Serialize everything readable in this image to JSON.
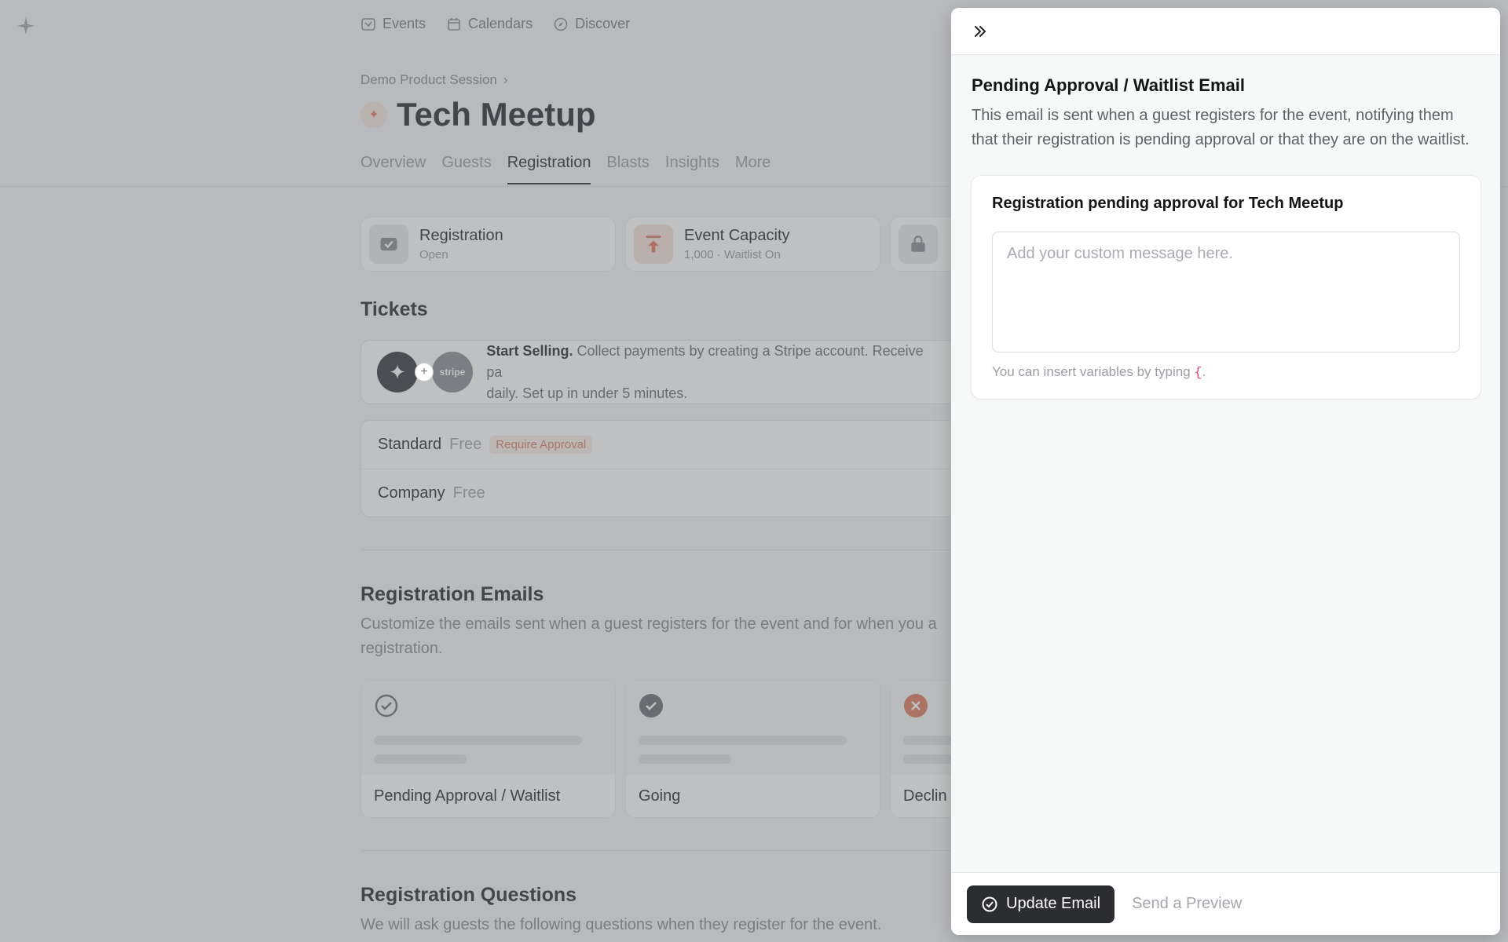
{
  "topnav": {
    "items": [
      {
        "label": "Events",
        "icon": "ticket-icon"
      },
      {
        "label": "Calendars",
        "icon": "calendar-icon"
      },
      {
        "label": "Discover",
        "icon": "compass-icon"
      }
    ]
  },
  "event": {
    "breadcrumb": "Demo Product Session",
    "title": "Tech Meetup"
  },
  "tabs": [
    {
      "label": "Overview",
      "active": false
    },
    {
      "label": "Guests",
      "active": false
    },
    {
      "label": "Registration",
      "active": true
    },
    {
      "label": "Blasts",
      "active": false
    },
    {
      "label": "Insights",
      "active": false
    },
    {
      "label": "More",
      "active": false
    }
  ],
  "stat_cards": [
    {
      "title": "Registration",
      "sub": "Open",
      "icon": "ticket-check-icon",
      "color": "#8a8d92"
    },
    {
      "title": "Event Capacity",
      "sub": "1,000 · Waitlist On",
      "icon": "arrow-up-icon",
      "color": "#e07a5f"
    },
    {
      "title": "",
      "sub": "",
      "icon": "lock-icon",
      "color": "#8a8d92"
    }
  ],
  "tickets": {
    "heading": "Tickets",
    "stripe_bold": "Start Selling.",
    "stripe_text": "Collect payments by creating a Stripe account. Receive pa",
    "stripe_text2": "daily. Set up in under 5 minutes.",
    "stripe_logo": "stripe",
    "rows": [
      {
        "name": "Standard",
        "price": "Free",
        "badge": "Require Approval"
      },
      {
        "name": "Company",
        "price": "Free",
        "badge": ""
      }
    ]
  },
  "reg_emails": {
    "heading": "Registration Emails",
    "desc": "Customize the emails sent when a guest registers for the event and for when you a",
    "desc2": "registration.",
    "cards": [
      {
        "label": "Pending Approval / Waitlist",
        "icon": "check-circle-outline-icon"
      },
      {
        "label": "Going",
        "icon": "check-circle-filled-icon"
      },
      {
        "label": "Declin",
        "icon": "x-circle-icon"
      }
    ]
  },
  "reg_questions": {
    "heading": "Registration Questions",
    "desc": "We will ask guests the following questions when they register for the event."
  },
  "panel": {
    "heading": "Pending Approval / Waitlist Email",
    "desc": "This email is sent when a guest registers for the event, notifying them that their registration is pending approval or that they are on the waitlist.",
    "subject": "Registration pending approval for Tech Meetup",
    "message_placeholder": "Add your custom message here.",
    "message_value": "",
    "hint_text": "You can insert variables by typing",
    "hint_brace": "{",
    "hint_end": ".",
    "update_label": "Update Email",
    "preview_label": "Send a Preview"
  },
  "colors": {
    "accent": "#e07a5f",
    "primary_button": "#2b2d31",
    "brace": "#e0447a"
  }
}
